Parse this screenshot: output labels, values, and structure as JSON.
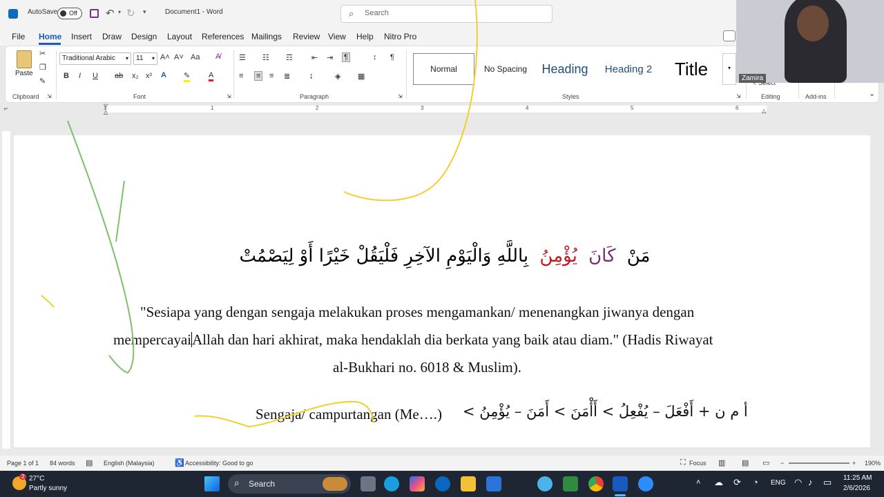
{
  "titlebar": {
    "autosave_label": "AutoSave",
    "autosave_state": "Off",
    "doc_title": "Document1 - Word",
    "search_placeholder": "Search"
  },
  "menu": [
    "File",
    "Home",
    "Insert",
    "Draw",
    "Design",
    "Layout",
    "References",
    "Mailings",
    "Review",
    "View",
    "Help",
    "Nitro Pro"
  ],
  "ribbon": {
    "clipboard": {
      "paste_label": "Paste",
      "group_label": "Clipboard"
    },
    "font": {
      "font_name": "Traditional Arabic",
      "font_size": "11",
      "group_label": "Font",
      "bold": "B",
      "italic": "I",
      "underline": "U",
      "strike": "ab",
      "change_case": "Aa"
    },
    "paragraph": {
      "group_label": "Paragraph"
    },
    "styles": {
      "items": [
        "Normal",
        "No Spacing",
        "Heading",
        "Heading 2",
        "Title"
      ],
      "group_label": "Styles"
    },
    "editing": {
      "group_label": "Editing",
      "select_label": "Select"
    },
    "addins": {
      "group_label": "Add-ins"
    }
  },
  "ruler": {
    "numbers": [
      "1",
      "1",
      "2",
      "3",
      "4",
      "5",
      "6"
    ]
  },
  "document": {
    "arabic_words": [
      {
        "text": "مَنْ",
        "color": "#000000"
      },
      {
        "text": "كَانَ",
        "color": "#7b2d6e"
      },
      {
        "text": "يُؤْمِنُ",
        "color": "#c0181e"
      },
      {
        "text": "بِاللَّهِ وَالْيَوْمِ الآخِرِ فَلْيَقُلْ خَيْرًا أَوْ لِيَصْمُتْ",
        "color": "#000000"
      }
    ],
    "line1": "\"Sesiapa yang dengan sengaja melakukan proses mengamankan/ menenangkan jiwanya dengan",
    "line2_before_caret": "mempercayai",
    "line2_after_caret": "Allah dan hari akhirat, maka hendaklah dia berkata yang baik atau diam.\" (Hadis Riwayat",
    "line3": "al-Bukhari no. 6018 & Muslim).",
    "line4_latin": "Sengaja/ campurtangan (Me….)",
    "line4_arabic": "أ م ن + أَفْعَلَ – يُفْعِلُ > أَأْمَنَ > أَمَنَ – يُؤْمِنُ >"
  },
  "status": {
    "page": "Page 1 of 1",
    "words": "84 words",
    "language": "English (Malaysia)",
    "accessibility": "Accessibility: Good to go",
    "focus": "Focus",
    "zoom": "190%"
  },
  "taskbar": {
    "weather_temp": "27°C",
    "weather_desc": "Partly sunny",
    "weather_badge": "2",
    "search_label": "Search",
    "lang": "ENG",
    "time": "11:25 AM",
    "date": "2/6/2026"
  },
  "webcam": {
    "name": "Zamira"
  },
  "colors": {
    "accent": "#185abd",
    "heading": "#1f4e79",
    "annotation_yellow": "#f1cf2c",
    "annotation_green": "#7cc06a"
  }
}
